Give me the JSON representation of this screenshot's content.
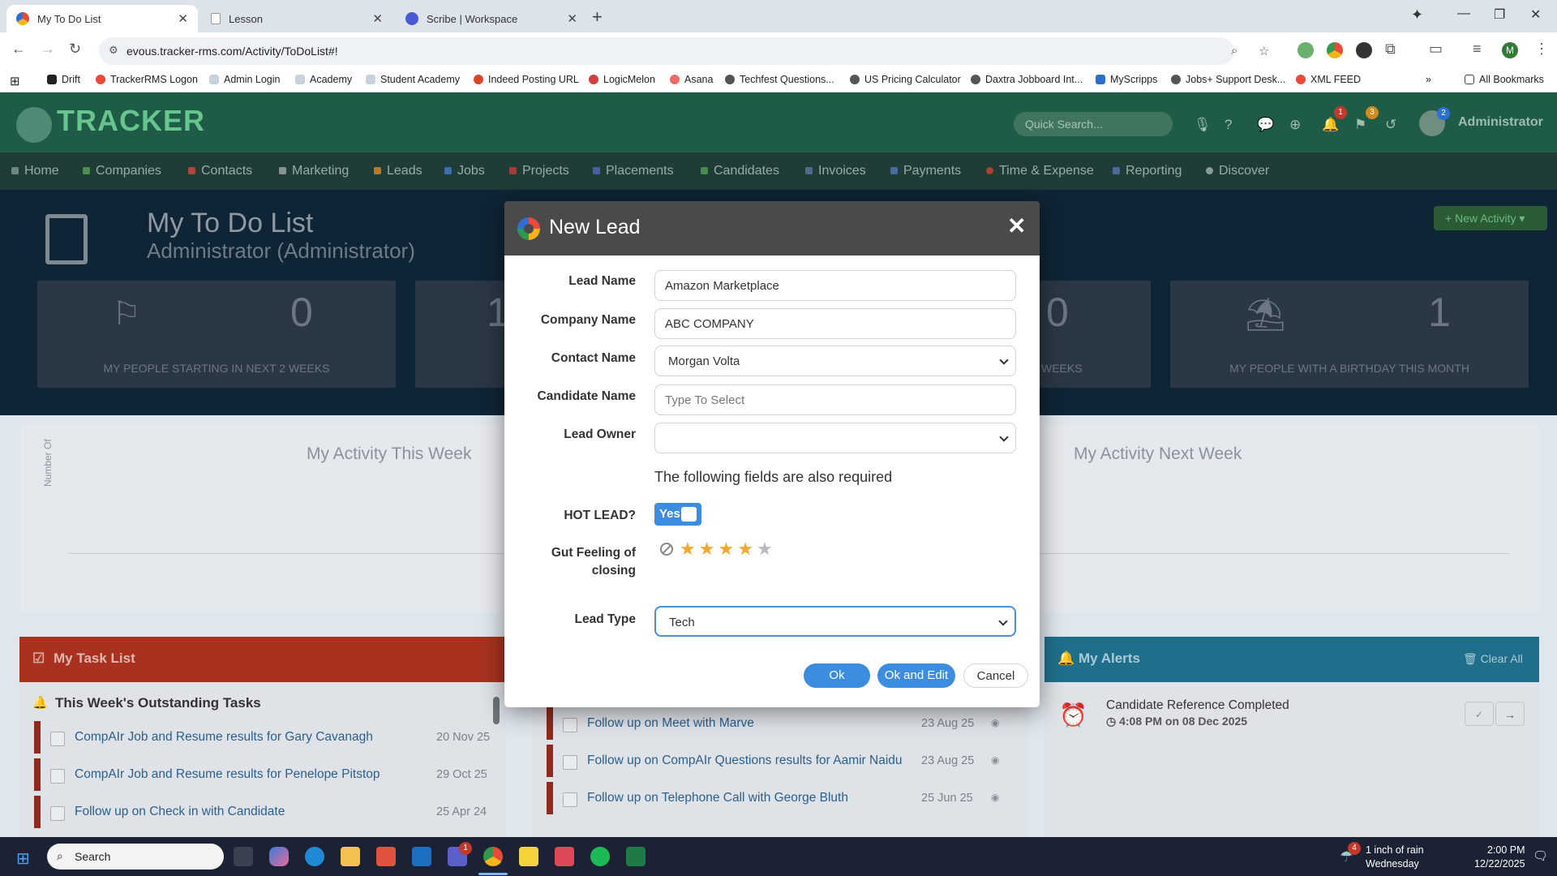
{
  "browser": {
    "tabs": [
      {
        "title": "My To Do List",
        "active": true
      },
      {
        "title": "Lesson",
        "active": false
      },
      {
        "title": "Scribe | Workspace",
        "active": false
      }
    ],
    "url": "evous.tracker-rms.com/Activity/ToDoList#!",
    "bookmarks": [
      "Drift",
      "TrackerRMS Logon",
      "Admin Login",
      "Academy",
      "Student Academy",
      "Indeed Posting URL",
      "LogicMelon",
      "Asana",
      "Techfest Questions...",
      "US Pricing Calculator",
      "Daxtra Jobboard Int...",
      "MyScripps",
      "Jobs+ Support Desk...",
      "XML FEED"
    ],
    "all_bookmarks": "All Bookmarks",
    "profile_initial": "M"
  },
  "app": {
    "logo_text": "TRACKER",
    "search_placeholder": "Quick Search...",
    "user_name": "Administrator",
    "badges": {
      "notifications": "1",
      "flags": "3",
      "avatar": "2"
    },
    "nav": [
      "Home",
      "Companies",
      "Contacts",
      "Marketing",
      "Leads",
      "Jobs",
      "Projects",
      "Placements",
      "Candidates",
      "Invoices",
      "Payments",
      "Time & Expense",
      "Reporting",
      "Discover"
    ],
    "page_title": "My To Do List",
    "page_subtitle": "Administrator (Administrator)",
    "new_activity": "New Activity",
    "stats": [
      {
        "value": "0",
        "label": "MY PEOPLE STARTING IN NEXT 2 WEEKS"
      },
      {
        "value": "0",
        "label": "WEEKS"
      },
      {
        "value": "1",
        "label": "MY PEOPLE WITH A BIRTHDAY THIS MONTH"
      }
    ],
    "activity_this_week": "My Activity This Week",
    "activity_next_week": "My Activity Next Week",
    "y_axis": "Number Of",
    "task_list_title": "My Task List",
    "outstanding_title": "This Week's Outstanding Tasks",
    "tasks_left": [
      {
        "text": "CompAIr Job and Resume results for Gary Cavanagh",
        "date": "20 Nov 25"
      },
      {
        "text": "CompAIr Job and Resume results for Penelope Pitstop",
        "date": "29 Oct 25"
      },
      {
        "text": "Follow up on Check in with Candidate",
        "date": "25 Apr 24"
      }
    ],
    "tasks_mid": [
      {
        "text": "Follow up on Meet with Marve",
        "date": "23 Aug 25"
      },
      {
        "text": "Follow up on CompAIr Questions results for Aamir Naidu",
        "date": "23 Aug 25"
      },
      {
        "text": "Follow up on Telephone Call with George Bluth",
        "date": "25 Jun 25"
      }
    ],
    "alerts_title": "My Alerts",
    "clear_all": "Clear All",
    "alert": {
      "title": "Candidate Reference Completed",
      "time": "4:08 PM on 08 Dec 2025"
    }
  },
  "modal": {
    "title": "New Lead",
    "close_glyph": "✕",
    "fields": {
      "lead_name": {
        "label": "Lead Name",
        "value": "Amazon Marketplace"
      },
      "company_name": {
        "label": "Company Name",
        "value": "ABC COMPANY"
      },
      "contact_name": {
        "label": "Contact Name",
        "value": "Morgan Volta"
      },
      "candidate_name": {
        "label": "Candidate Name",
        "placeholder": "Type To Select"
      },
      "lead_owner": {
        "label": "Lead Owner",
        "value": ""
      }
    },
    "required_note": "The following fields are also required",
    "hot_lead": {
      "label": "HOT LEAD?",
      "value": "Yes"
    },
    "gut_feeling": {
      "label_line1": "Gut Feeling of",
      "label_line2": "closing",
      "rating": 4,
      "max": 5
    },
    "lead_type": {
      "label": "Lead Type",
      "value": "Tech"
    },
    "buttons": {
      "ok": "Ok",
      "ok_edit": "Ok and Edit",
      "cancel": "Cancel"
    },
    "colors": {
      "primary": "#3c8de0",
      "header": "#4a4a4a",
      "star": "#f0a830"
    }
  },
  "taskbar": {
    "search": "Search",
    "weather": "1 inch of rain",
    "weather_day": "Wednesday",
    "time": "2:00 PM",
    "date": "12/22/2025",
    "weather_badge": "4",
    "teams_badge": "1"
  }
}
